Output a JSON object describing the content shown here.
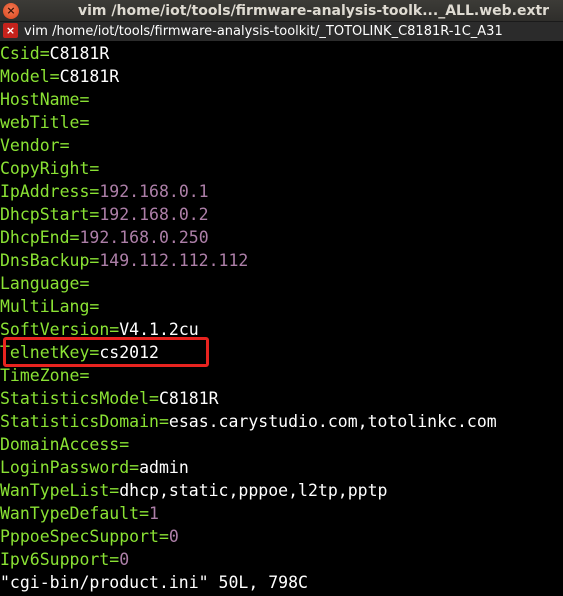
{
  "window": {
    "title": "vim  /home/iot/tools/firmware-analysis-toolk..._ALL.web.extr",
    "close_glyph": "×"
  },
  "tab": {
    "label": "vim  /home/iot/tools/firmware-analysis-toolkit/_TOTOLINK_C8181R-1C_A31",
    "close_glyph": "×"
  },
  "lines": [
    {
      "key": "Csid=",
      "value": "C8181R",
      "kind": "text"
    },
    {
      "key": "Model=",
      "value": "C8181R",
      "kind": "text"
    },
    {
      "key": "HostName=",
      "value": "",
      "kind": "text"
    },
    {
      "key": "webTitle=",
      "value": "",
      "kind": "text"
    },
    {
      "key": "Vendor=",
      "value": "",
      "kind": "text"
    },
    {
      "key": "CopyRight=",
      "value": "",
      "kind": "text"
    },
    {
      "key": "IpAddress=",
      "value": "192.168.0.1",
      "kind": "num"
    },
    {
      "key": "DhcpStart=",
      "value": "192.168.0.2",
      "kind": "num"
    },
    {
      "key": "DhcpEnd=",
      "value": "192.168.0.250",
      "kind": "num"
    },
    {
      "key": "DnsBackup=",
      "value": "149.112.112.112",
      "kind": "num"
    },
    {
      "key": "Language=",
      "value": "",
      "kind": "text"
    },
    {
      "key": "MultiLang=",
      "value": "",
      "kind": "text"
    },
    {
      "key": "SoftVersion=",
      "value": "V4.1.2cu",
      "kind": "text"
    },
    {
      "key": "TelnetKey=",
      "value": "cs2012",
      "kind": "text"
    },
    {
      "key": "TimeZone=",
      "value": "",
      "kind": "text"
    },
    {
      "key": "StatisticsModel=",
      "value": "C8181R",
      "kind": "text"
    },
    {
      "key": "StatisticsDomain=",
      "value": "esas.carystudio.com,totolinkc.com",
      "kind": "text"
    },
    {
      "key": "DomainAccess=",
      "value": "",
      "kind": "text"
    },
    {
      "key": "LoginPassword=",
      "value": "admin",
      "kind": "text"
    },
    {
      "key": "WanTypeList=",
      "value": "dhcp,static,pppoe,l2tp,pptp",
      "kind": "text"
    },
    {
      "key": "WanTypeDefault=",
      "value": "1",
      "kind": "num"
    },
    {
      "key": "PppoeSpecSupport=",
      "value": "0",
      "kind": "num"
    },
    {
      "key": "Ipv6Support=",
      "value": "0",
      "kind": "num"
    }
  ],
  "status_line": "\"cgi-bin/product.ini\" 50L, 798C",
  "colors": {
    "key": "#8ae234",
    "value": "#ffffff",
    "number": "#ad7fa8",
    "highlight_box": "#e8231f"
  }
}
